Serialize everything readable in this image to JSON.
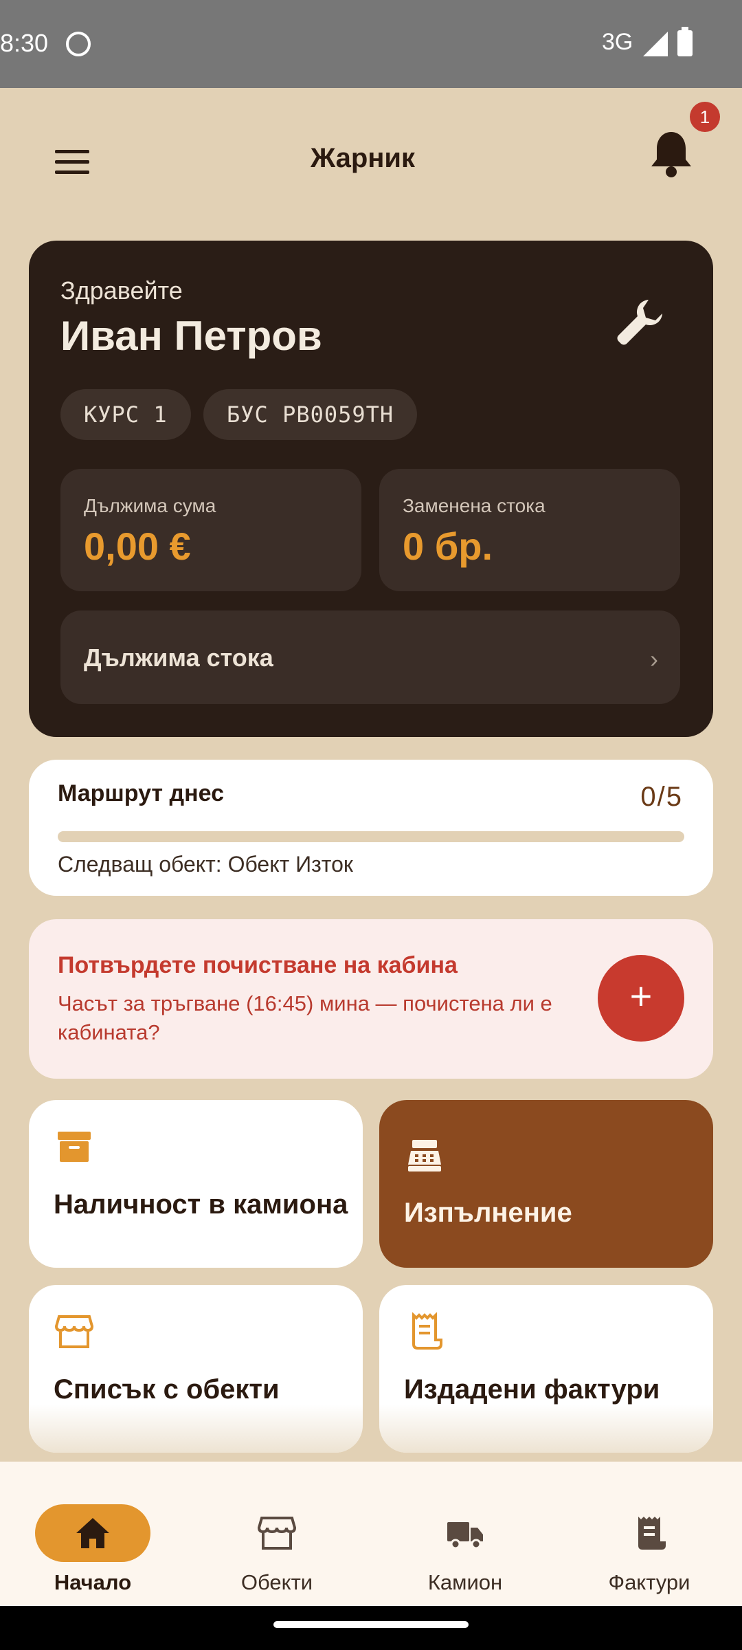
{
  "status_bar": {
    "time": "8:30",
    "network": "3G"
  },
  "app_bar": {
    "title": "Жарник",
    "notification_count": "1"
  },
  "profile": {
    "greeting": "Здравейте",
    "name": "Иван Петров",
    "chips": [
      "КУРС 1",
      "БУС PB0059TH"
    ],
    "stats": [
      {
        "label": "Дължима сума",
        "value": "0,00 €"
      },
      {
        "label": "Заменена стока",
        "value": "0 бр."
      }
    ],
    "owed_goods_label": "Дължима стока",
    "owed_goods_chevron": "›"
  },
  "route": {
    "title": "Маршрут днес",
    "count": "0/5",
    "progress": 0,
    "next": "Следващ обект: Обект Изток"
  },
  "alert": {
    "title": "Потвърдете почистване на кабина",
    "text": "Часът за тръгване (16:45) мина — почистена ли е кабината?",
    "fab": "+"
  },
  "tiles": [
    {
      "label": "Наличност в камиона",
      "icon": "archive-box-icon"
    },
    {
      "label": "Изпълнение",
      "icon": "cash-register-icon"
    },
    {
      "label": "Списък с обекти",
      "icon": "storefront-icon"
    },
    {
      "label": "Издадени фактури",
      "icon": "receipt-icon"
    }
  ],
  "bottom_nav": [
    {
      "label": "Начало",
      "icon": "home-icon",
      "active": true
    },
    {
      "label": "Обекти",
      "icon": "storefront-icon",
      "active": false
    },
    {
      "label": "Камион",
      "icon": "truck-icon",
      "active": false
    },
    {
      "label": "Фактури",
      "icon": "receipt-icon",
      "active": false
    }
  ],
  "colors": {
    "background": "#E2D1B5",
    "dark_card": "#2A1D16",
    "accent_orange": "#E89A2E",
    "brown": "#8B4A1F",
    "alert_red": "#C43A2E",
    "alert_bg": "#FBEDEB"
  }
}
